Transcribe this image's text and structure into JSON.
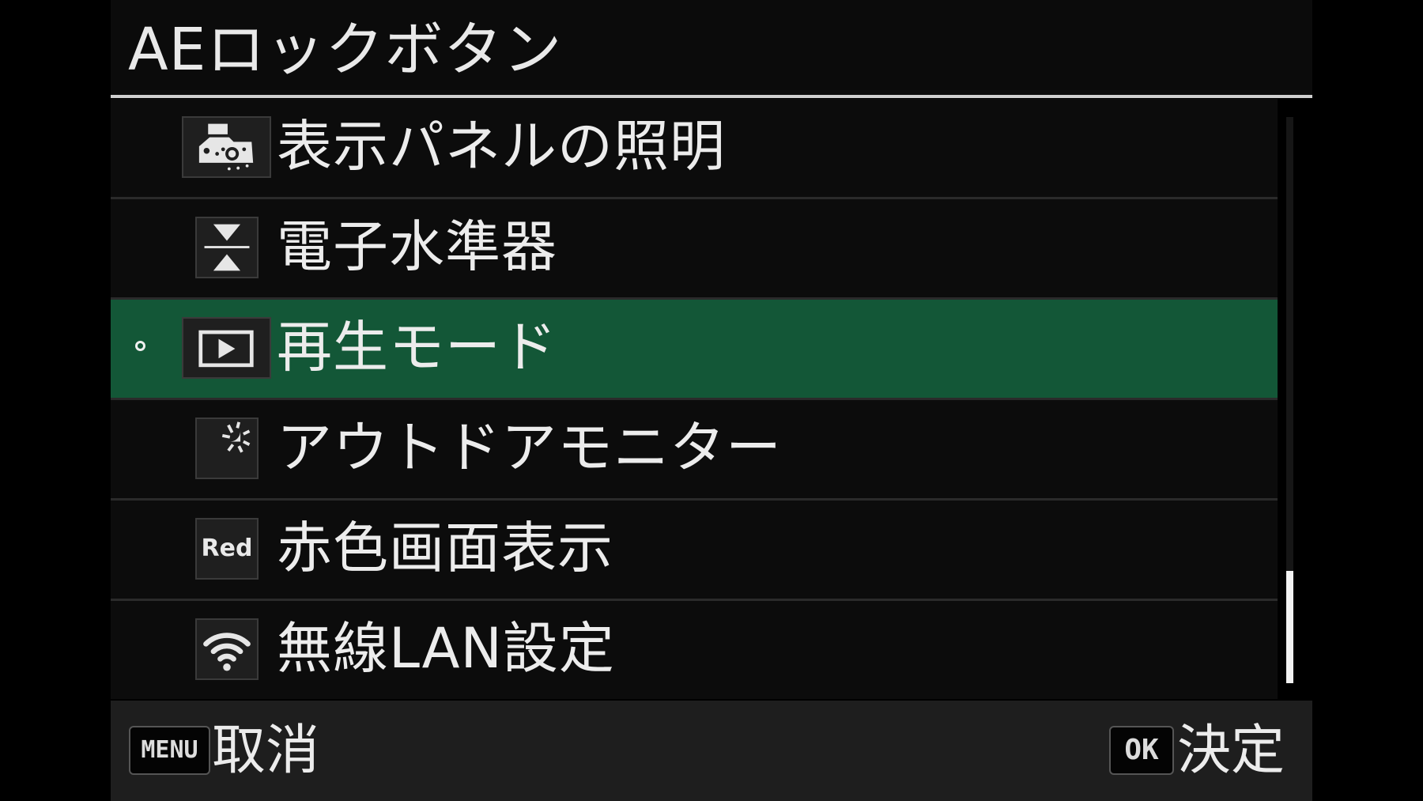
{
  "screen": {
    "title": "AEロックボタン"
  },
  "menu": {
    "items": [
      {
        "label": "表示パネルの照明",
        "icon": "display-panel-light-icon",
        "selected": false
      },
      {
        "label": "電子水準器",
        "icon": "electronic-level-icon",
        "selected": false
      },
      {
        "label": "再生モード",
        "icon": "playback-icon",
        "selected": true
      },
      {
        "label": "アウトドアモニター",
        "icon": "outdoor-monitor-icon",
        "selected": false
      },
      {
        "label": "赤色画面表示",
        "icon": "red-screen-icon",
        "icon_text": "Red",
        "selected": false
      },
      {
        "label": "無線LAN設定",
        "icon": "wifi-icon",
        "selected": false
      }
    ]
  },
  "footer": {
    "menu_key": "MENU",
    "cancel_label": "取消",
    "ok_key": "OK",
    "confirm_label": "決定"
  },
  "colors": {
    "selected_row": "#135737",
    "background": "#000000",
    "footer": "#1e1e1e"
  }
}
